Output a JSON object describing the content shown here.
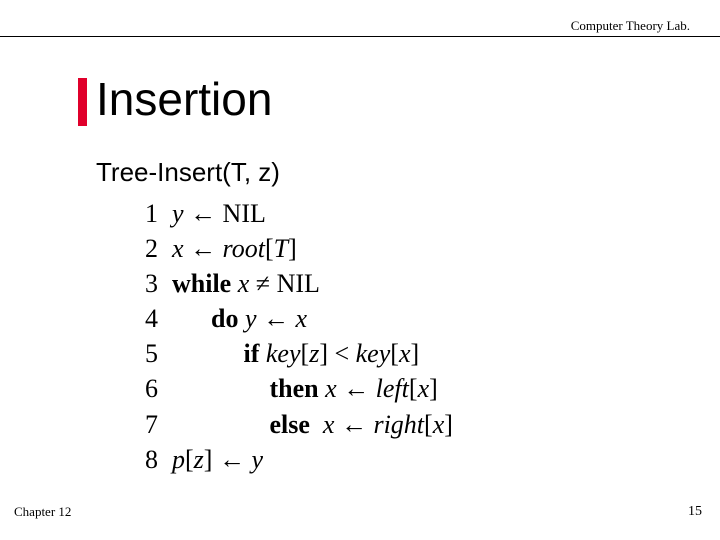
{
  "header": {
    "lab": "Computer Theory Lab."
  },
  "title": "Insertion",
  "subtitle": "Tree-Insert(T, z)",
  "pseudo": {
    "lines": [
      {
        "n": "1",
        "html": "<span class='it'>y</span> ← <span class='nil'>NIL</span>"
      },
      {
        "n": "2",
        "html": "<span class='it'>x</span> ← <span class='it'>root</span>[<span class='it'>T</span>]"
      },
      {
        "n": "3",
        "html": "<span class='kw'>while</span> <span class='it'>x</span> ≠ <span class='nil'>NIL</span>"
      },
      {
        "n": "4",
        "html": "      <span class='kw'>do</span> <span class='it'>y</span> ← <span class='it'>x</span>"
      },
      {
        "n": "5",
        "html": "           <span class='kw'>if</span> <span class='it'>key</span>[<span class='it'>z</span>] &lt; <span class='it'>key</span>[<span class='it'>x</span>]"
      },
      {
        "n": "6",
        "html": "               <span class='kw'>then</span> <span class='it'>x</span> ← <span class='it'>left</span>[<span class='it'>x</span>]"
      },
      {
        "n": "7",
        "html": "               <span class='kw'>else</span>  <span class='it'>x</span> ← <span class='it'>right</span>[<span class='it'>x</span>]"
      },
      {
        "n": "8",
        "html": "<span class='it'>p</span>[<span class='it'>z</span>] ← <span class='it'>y</span>"
      }
    ]
  },
  "footer": {
    "chapter": "Chapter 12",
    "slide": "15"
  }
}
